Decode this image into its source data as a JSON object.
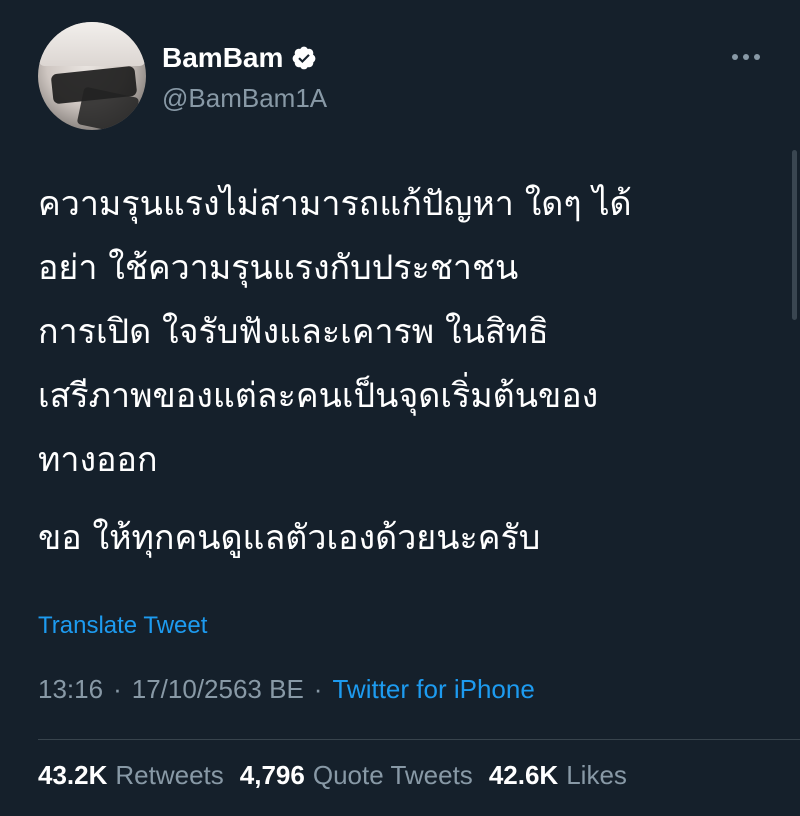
{
  "author": {
    "display_name": "BamBam",
    "handle": "@BamBam1A",
    "verified_icon": "verified-badge-icon",
    "avatar_icon": "profile-photo"
  },
  "more_icon": "more-options-icon",
  "tweet": {
    "lines": [
      "ความรุนแรงไม่สามารถแก้ปัญหา ใดๆ ได้",
      "อย่า ใช้ความรุนแรงกับประชาชน",
      "การเปิด ใจรับฟังและเคารพ ในสิทธิ",
      "เสรีภาพของแต่ละคนเป็นจุดเริ่มต้นของ",
      "ทางออก"
    ],
    "closing": "ขอ ให้ทุกคนดูแลตัวเองด้วยนะครับ"
  },
  "translate_label": "Translate Tweet",
  "meta": {
    "time": "13:16",
    "sep1": "·",
    "date": "17/10/2563 BE",
    "sep2": "·",
    "source": "Twitter for iPhone"
  },
  "stats": {
    "retweets_count": "43.2K",
    "retweets_label": "Retweets",
    "quotes_count": "4,796",
    "quotes_label": "Quote Tweets",
    "likes_count": "42.6K",
    "likes_label": "Likes"
  },
  "colors": {
    "background": "#15202b",
    "secondary_text": "#8899a6",
    "link": "#1d9bf0"
  }
}
